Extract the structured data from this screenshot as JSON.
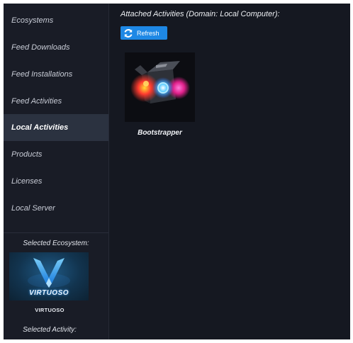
{
  "sidebar": {
    "items": [
      {
        "label": "Ecosystems",
        "active": false
      },
      {
        "label": "Feed Downloads",
        "active": false
      },
      {
        "label": "Feed Installations",
        "active": false
      },
      {
        "label": "Feed Activities",
        "active": false
      },
      {
        "label": "Local Activities",
        "active": true
      },
      {
        "label": "Products",
        "active": false
      },
      {
        "label": "Licenses",
        "active": false
      },
      {
        "label": "Local Server",
        "active": false
      }
    ],
    "selected_ecosystem_label": "Selected Ecosystem:",
    "ecosystem_logo_text": "VIRTUOSO",
    "ecosystem_name": "VIRTUOSO",
    "selected_activity_label": "Selected Activity:"
  },
  "main": {
    "title": "Attached Activities (Domain: Local Computer):",
    "refresh_label": "Refresh",
    "refresh_icon": "refresh-icon",
    "activities": [
      {
        "label": "Bootstrapper",
        "icon": "bootstrapper-box-icon"
      }
    ]
  },
  "colors": {
    "background": "#151821",
    "sidebar": "#191c26",
    "active_item": "#2b3240",
    "accent": "#1e88e5"
  }
}
